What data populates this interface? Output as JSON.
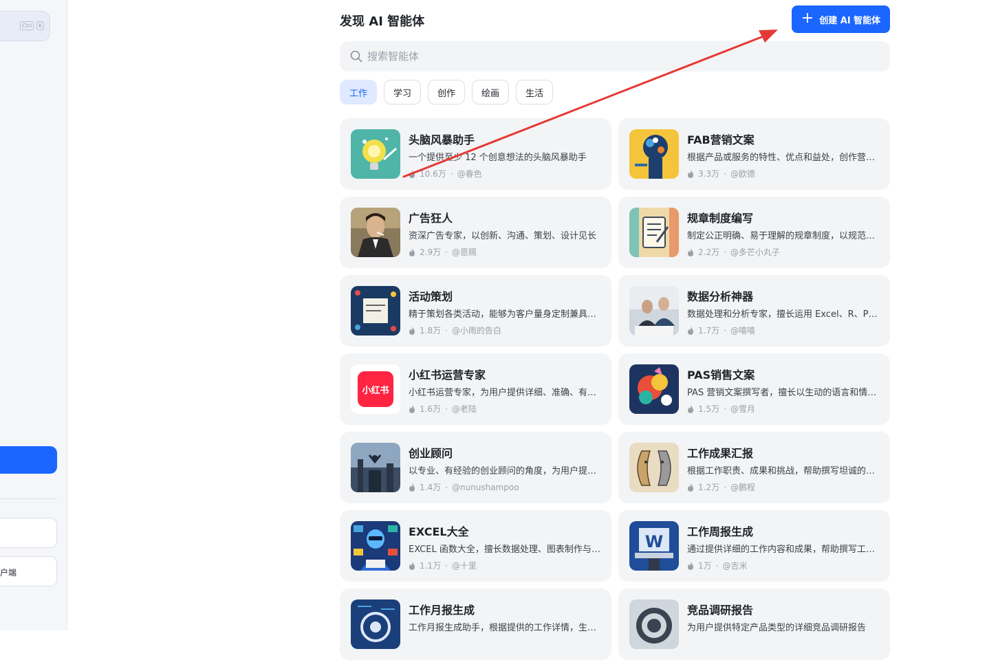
{
  "sidebar": {
    "shortcut_keys": [
      "Ctrl",
      "K"
    ],
    "box_label": "户端"
  },
  "header": {
    "title": "发现 AI 智能体",
    "create_label": "创建 AI 智能体"
  },
  "search": {
    "placeholder": "搜索智能体"
  },
  "tabs": [
    {
      "label": "工作",
      "active": true
    },
    {
      "label": "学习",
      "active": false
    },
    {
      "label": "创作",
      "active": false
    },
    {
      "label": "绘画",
      "active": false
    },
    {
      "label": "生活",
      "active": false
    }
  ],
  "agents": [
    {
      "title": "头脑风暴助手",
      "desc": "一个提供至少 12 个创意想法的头脑风暴助手",
      "count": "10.6万",
      "author": "@春色",
      "icon": "lightbulb-icon"
    },
    {
      "title": "FAB营销文案",
      "desc": "根据产品或服务的特性、优点和益处，创作营销文案",
      "count": "3.3万",
      "author": "@欧德",
      "icon": "gears-head-icon"
    },
    {
      "title": "广告狂人",
      "desc": "资深广告专家，以创新、沟通、策划、设计见长",
      "count": "2.9万",
      "author": "@恩赐",
      "icon": "adman-portrait-icon"
    },
    {
      "title": "规章制度编写",
      "desc": "制定公正明确、易于理解的规章制度，以规范管理",
      "count": "2.2万",
      "author": "@多芒小丸子",
      "icon": "document-edit-icon"
    },
    {
      "title": "活动策划",
      "desc": "精于策划各类活动，能够为客户量身定制兼具创意的方案",
      "count": "1.8万",
      "author": "@小雨的告白",
      "icon": "planning-board-icon"
    },
    {
      "title": "数据分析神器",
      "desc": "数据处理和分析专家，擅长运用 Excel、R、Python",
      "count": "1.7万",
      "author": "@嘻嘻",
      "icon": "analysts-photo-icon"
    },
    {
      "title": "小红书运营专家",
      "desc": "小红书运营专家，为用户提供详细、准确、有效的建议",
      "count": "1.6万",
      "author": "@老陆",
      "icon": "xiaohongshu-logo-icon"
    },
    {
      "title": "PAS销售文案",
      "desc": "PAS 营销文案撰写者，擅长以生动的语言和情感打动客户",
      "count": "1.5万",
      "author": "@雪月",
      "icon": "colorful-art-icon"
    },
    {
      "title": "创业顾问",
      "desc": "以专业、有经验的创业顾问的角度，为用户提供建议",
      "count": "1.4万",
      "author": "@nunushampoo",
      "icon": "skyline-figure-icon"
    },
    {
      "title": "工作成果汇报",
      "desc": "根据工作职责、成果和挑战，帮助撰写坦诚的工作汇报",
      "count": "1.2万",
      "author": "@鹏程",
      "icon": "faces-sketch-icon"
    },
    {
      "title": "EXCEL大全",
      "desc": "EXCEL 函数大全，擅长数据处理、图表制作与公式应用",
      "count": "1.1万",
      "author": "@十里",
      "icon": "robot-dashboard-icon"
    },
    {
      "title": "工作周报生成",
      "desc": "通过提供详细的工作内容和成果，帮助撰写工作周报",
      "count": "1万",
      "author": "@吉米",
      "icon": "w-laptop-icon"
    },
    {
      "title": "工作月报生成",
      "desc": "工作月报生成助手，根据提供的工作详情，生成月报",
      "count": "",
      "author": "",
      "icon": "gear-circuit-icon"
    },
    {
      "title": "竞品调研报告",
      "desc": "为用户提供特定产品类型的详细竞品调研报告",
      "count": "",
      "author": "",
      "icon": "mechanical-ring-icon"
    }
  ],
  "colors": {
    "accent": "#1a66ff",
    "annotation": "#e53935"
  }
}
